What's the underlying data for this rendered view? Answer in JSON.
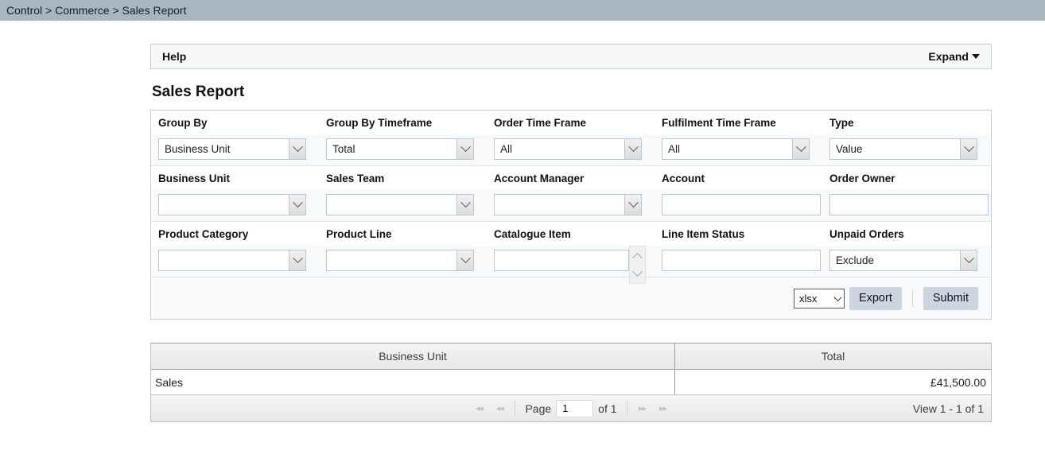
{
  "breadcrumb": {
    "items": [
      "Control",
      "Commerce",
      "Sales Report"
    ],
    "separator": " > "
  },
  "help": {
    "title": "Help",
    "expand_label": "Expand",
    "caret_icon": "caret-down-icon"
  },
  "page_title": "Sales Report",
  "filters": {
    "row1": [
      {
        "label": "Group By",
        "control": "select",
        "value": "Business Unit"
      },
      {
        "label": "Group By Timeframe",
        "control": "select",
        "value": "Total"
      },
      {
        "label": "Order Time Frame",
        "control": "select",
        "value": "All"
      },
      {
        "label": "Fulfilment Time Frame",
        "control": "select",
        "value": "All"
      },
      {
        "label": "Type",
        "control": "select",
        "value": "Value"
      }
    ],
    "row2": [
      {
        "label": "Business Unit",
        "control": "select",
        "value": ""
      },
      {
        "label": "Sales Team",
        "control": "select",
        "value": ""
      },
      {
        "label": "Account Manager",
        "control": "select",
        "value": ""
      },
      {
        "label": "Account",
        "control": "text",
        "value": "",
        "placeholder": ""
      },
      {
        "label": "Order Owner",
        "control": "text",
        "value": "",
        "placeholder": ""
      }
    ],
    "row3": [
      {
        "label": "Product Category",
        "control": "select",
        "value": ""
      },
      {
        "label": "Product Line",
        "control": "select",
        "value": ""
      },
      {
        "label": "Catalogue Item",
        "control": "listbox",
        "value": ""
      },
      {
        "label": "Line Item Status",
        "control": "text",
        "value": "",
        "placeholder": ""
      },
      {
        "label": "Unpaid Orders",
        "control": "select",
        "value": "Exclude"
      }
    ]
  },
  "actions": {
    "format_value": "xlsx",
    "export_label": "Export",
    "submit_label": "Submit"
  },
  "results": {
    "columns": [
      "Business Unit",
      "Total"
    ],
    "rows": [
      {
        "business_unit": "Sales",
        "total": "£41,500.00"
      }
    ],
    "pager": {
      "first_icon": "◄◄",
      "prev_icon": "◄◄",
      "page_label": "Page",
      "page_value": "1",
      "of_label": "of 1",
      "next_icon": "►►",
      "last_icon": "►►",
      "view_text": "View 1 - 1 of 1"
    }
  },
  "colors": {
    "breadcrumb_bg": "#a8b6bd",
    "panel_border": "#c3cfd4",
    "button_bg": "#ccd6e2",
    "field_row_bg": "#f7f9fa"
  }
}
